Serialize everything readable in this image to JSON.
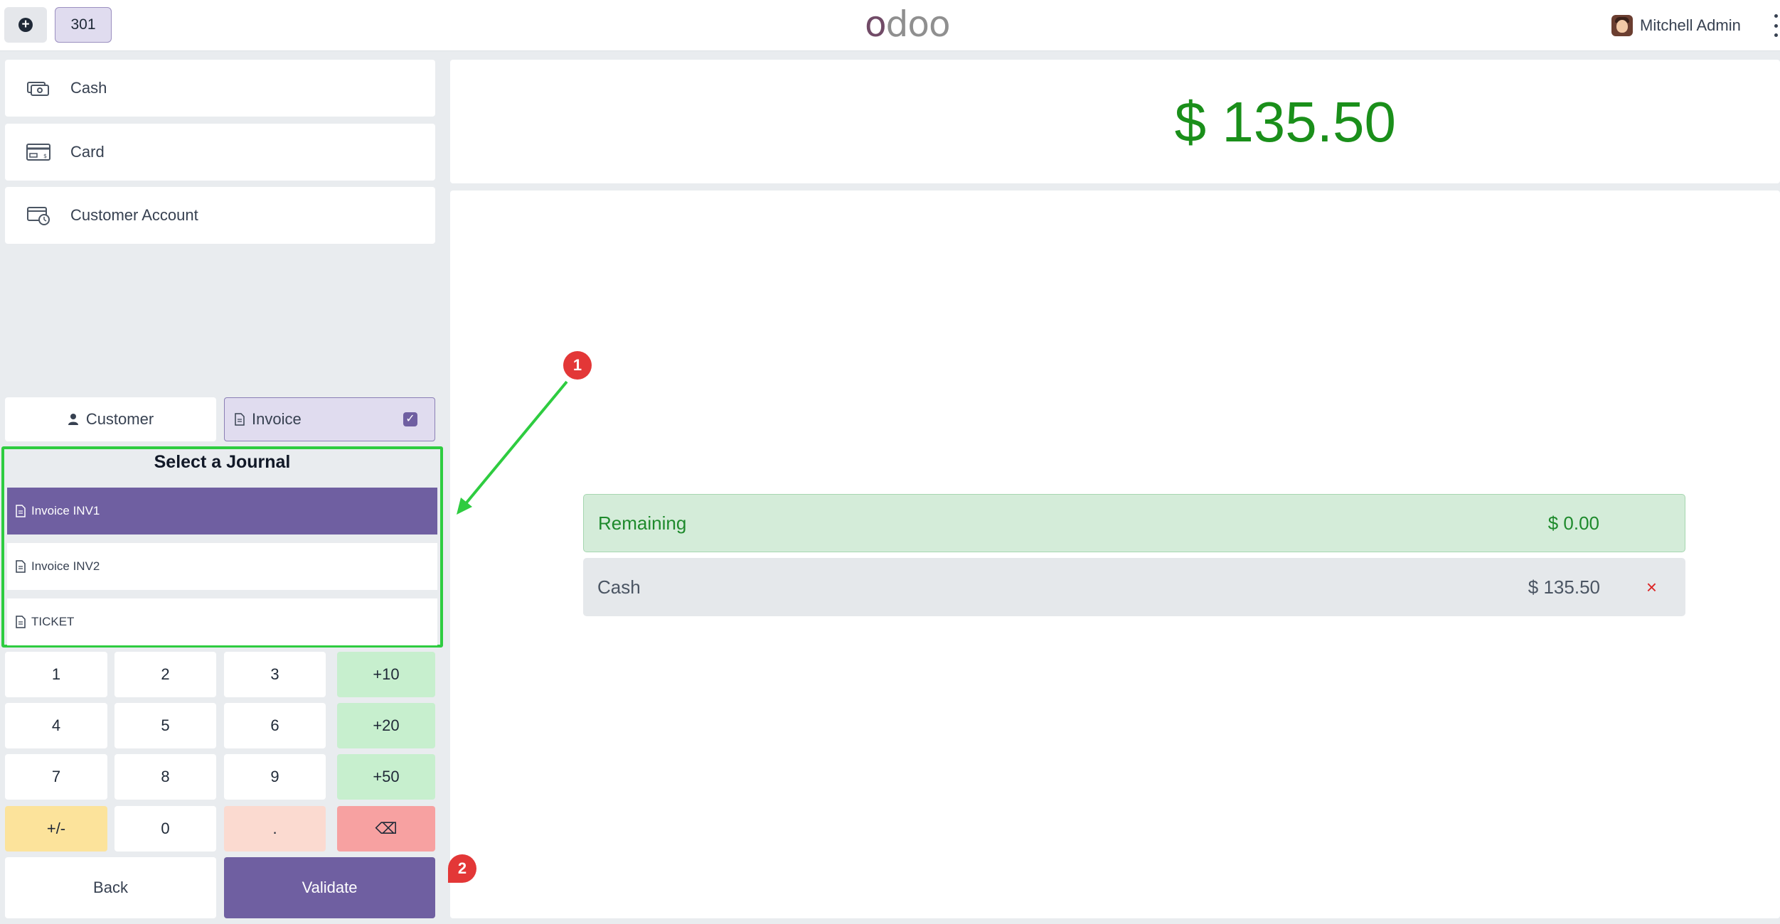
{
  "topbar": {
    "new_order_icon": "plus-circle-icon",
    "order_number": "301",
    "logo_text_1": "o",
    "logo_text_2": "d",
    "logo_text_3": "o",
    "logo_text_4": "o",
    "user_name": "Mitchell Admin"
  },
  "payment_methods": [
    {
      "label": "Cash",
      "icon": "cash-icon"
    },
    {
      "label": "Card",
      "icon": "card-icon"
    },
    {
      "label": "Customer Account",
      "icon": "customer-account-icon"
    }
  ],
  "toggles": {
    "customer_label": "Customer",
    "invoice_label": "Invoice",
    "invoice_checked": true
  },
  "journal": {
    "title": "Select a Journal",
    "items": [
      {
        "label": "Invoice INV1",
        "selected": true
      },
      {
        "label": "Invoice INV2",
        "selected": false
      },
      {
        "label": "TICKET",
        "selected": false
      }
    ]
  },
  "numpad": {
    "keys": [
      "1",
      "2",
      "3",
      "+10",
      "4",
      "5",
      "6",
      "+20",
      "7",
      "8",
      "9",
      "+50",
      "+/-",
      "0",
      ".",
      "⌫"
    ]
  },
  "actions": {
    "back_label": "Back",
    "validate_label": "Validate"
  },
  "summary": {
    "total": "$ 135.50",
    "remaining_label": "Remaining",
    "remaining_amount": "$ 0.00",
    "line_label": "Cash",
    "line_amount": "$ 135.50",
    "line_delete": "×"
  },
  "annotations": {
    "badge_1": "1",
    "badge_2": "2"
  },
  "colors": {
    "accent": "#6f5fa1",
    "highlight_border": "#2ecc40",
    "amount_green": "#1a8f1a",
    "badge_red": "#e33737"
  }
}
